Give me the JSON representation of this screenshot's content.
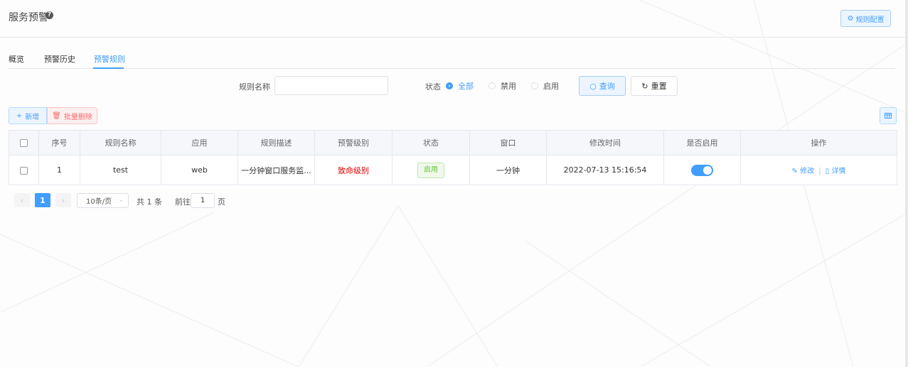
{
  "header": {
    "title": "服务预警",
    "help_icon": "question-circle-icon",
    "rule_config_label": "规则配置",
    "rule_config_icon": "gear-icon"
  },
  "tabs": [
    {
      "label": "概览",
      "active": false
    },
    {
      "label": "预警历史",
      "active": false
    },
    {
      "label": "预警规则",
      "active": true
    }
  ],
  "filters": {
    "name_label": "规则名称",
    "name_value": "",
    "name_placeholder": "",
    "status_label": "状态",
    "status_options": [
      {
        "label": "全部",
        "checked": true
      },
      {
        "label": "禁用",
        "checked": false
      },
      {
        "label": "启用",
        "checked": false
      }
    ],
    "query_label": "查询",
    "reset_label": "重置"
  },
  "toolbar": {
    "add_label": "新增",
    "batch_delete_label": "批量删除",
    "columns_icon": "table-columns-icon"
  },
  "table": {
    "headers": [
      "序号",
      "规则名称",
      "应用",
      "规则描述",
      "预警级别",
      "状态",
      "窗口",
      "修改时间",
      "是否启用",
      "操作"
    ],
    "rows": [
      {
        "index": "1",
        "name": "test",
        "app": "web",
        "description": "一分钟窗口服务监...",
        "level": "致命级别",
        "status": "启用",
        "window": "一分钟",
        "modified": "2022-07-13 15:16:54",
        "enabled": true,
        "edit_label": "修改",
        "detail_label": "详情"
      }
    ]
  },
  "pagination": {
    "current_page": "1",
    "page_size": "10条/页",
    "total": "共 1 条",
    "goto_label": "前往",
    "goto_value": "1",
    "page_unit": "页"
  },
  "colors": {
    "primary": "#409eff",
    "danger": "#e00000",
    "success": "#67c23a"
  }
}
